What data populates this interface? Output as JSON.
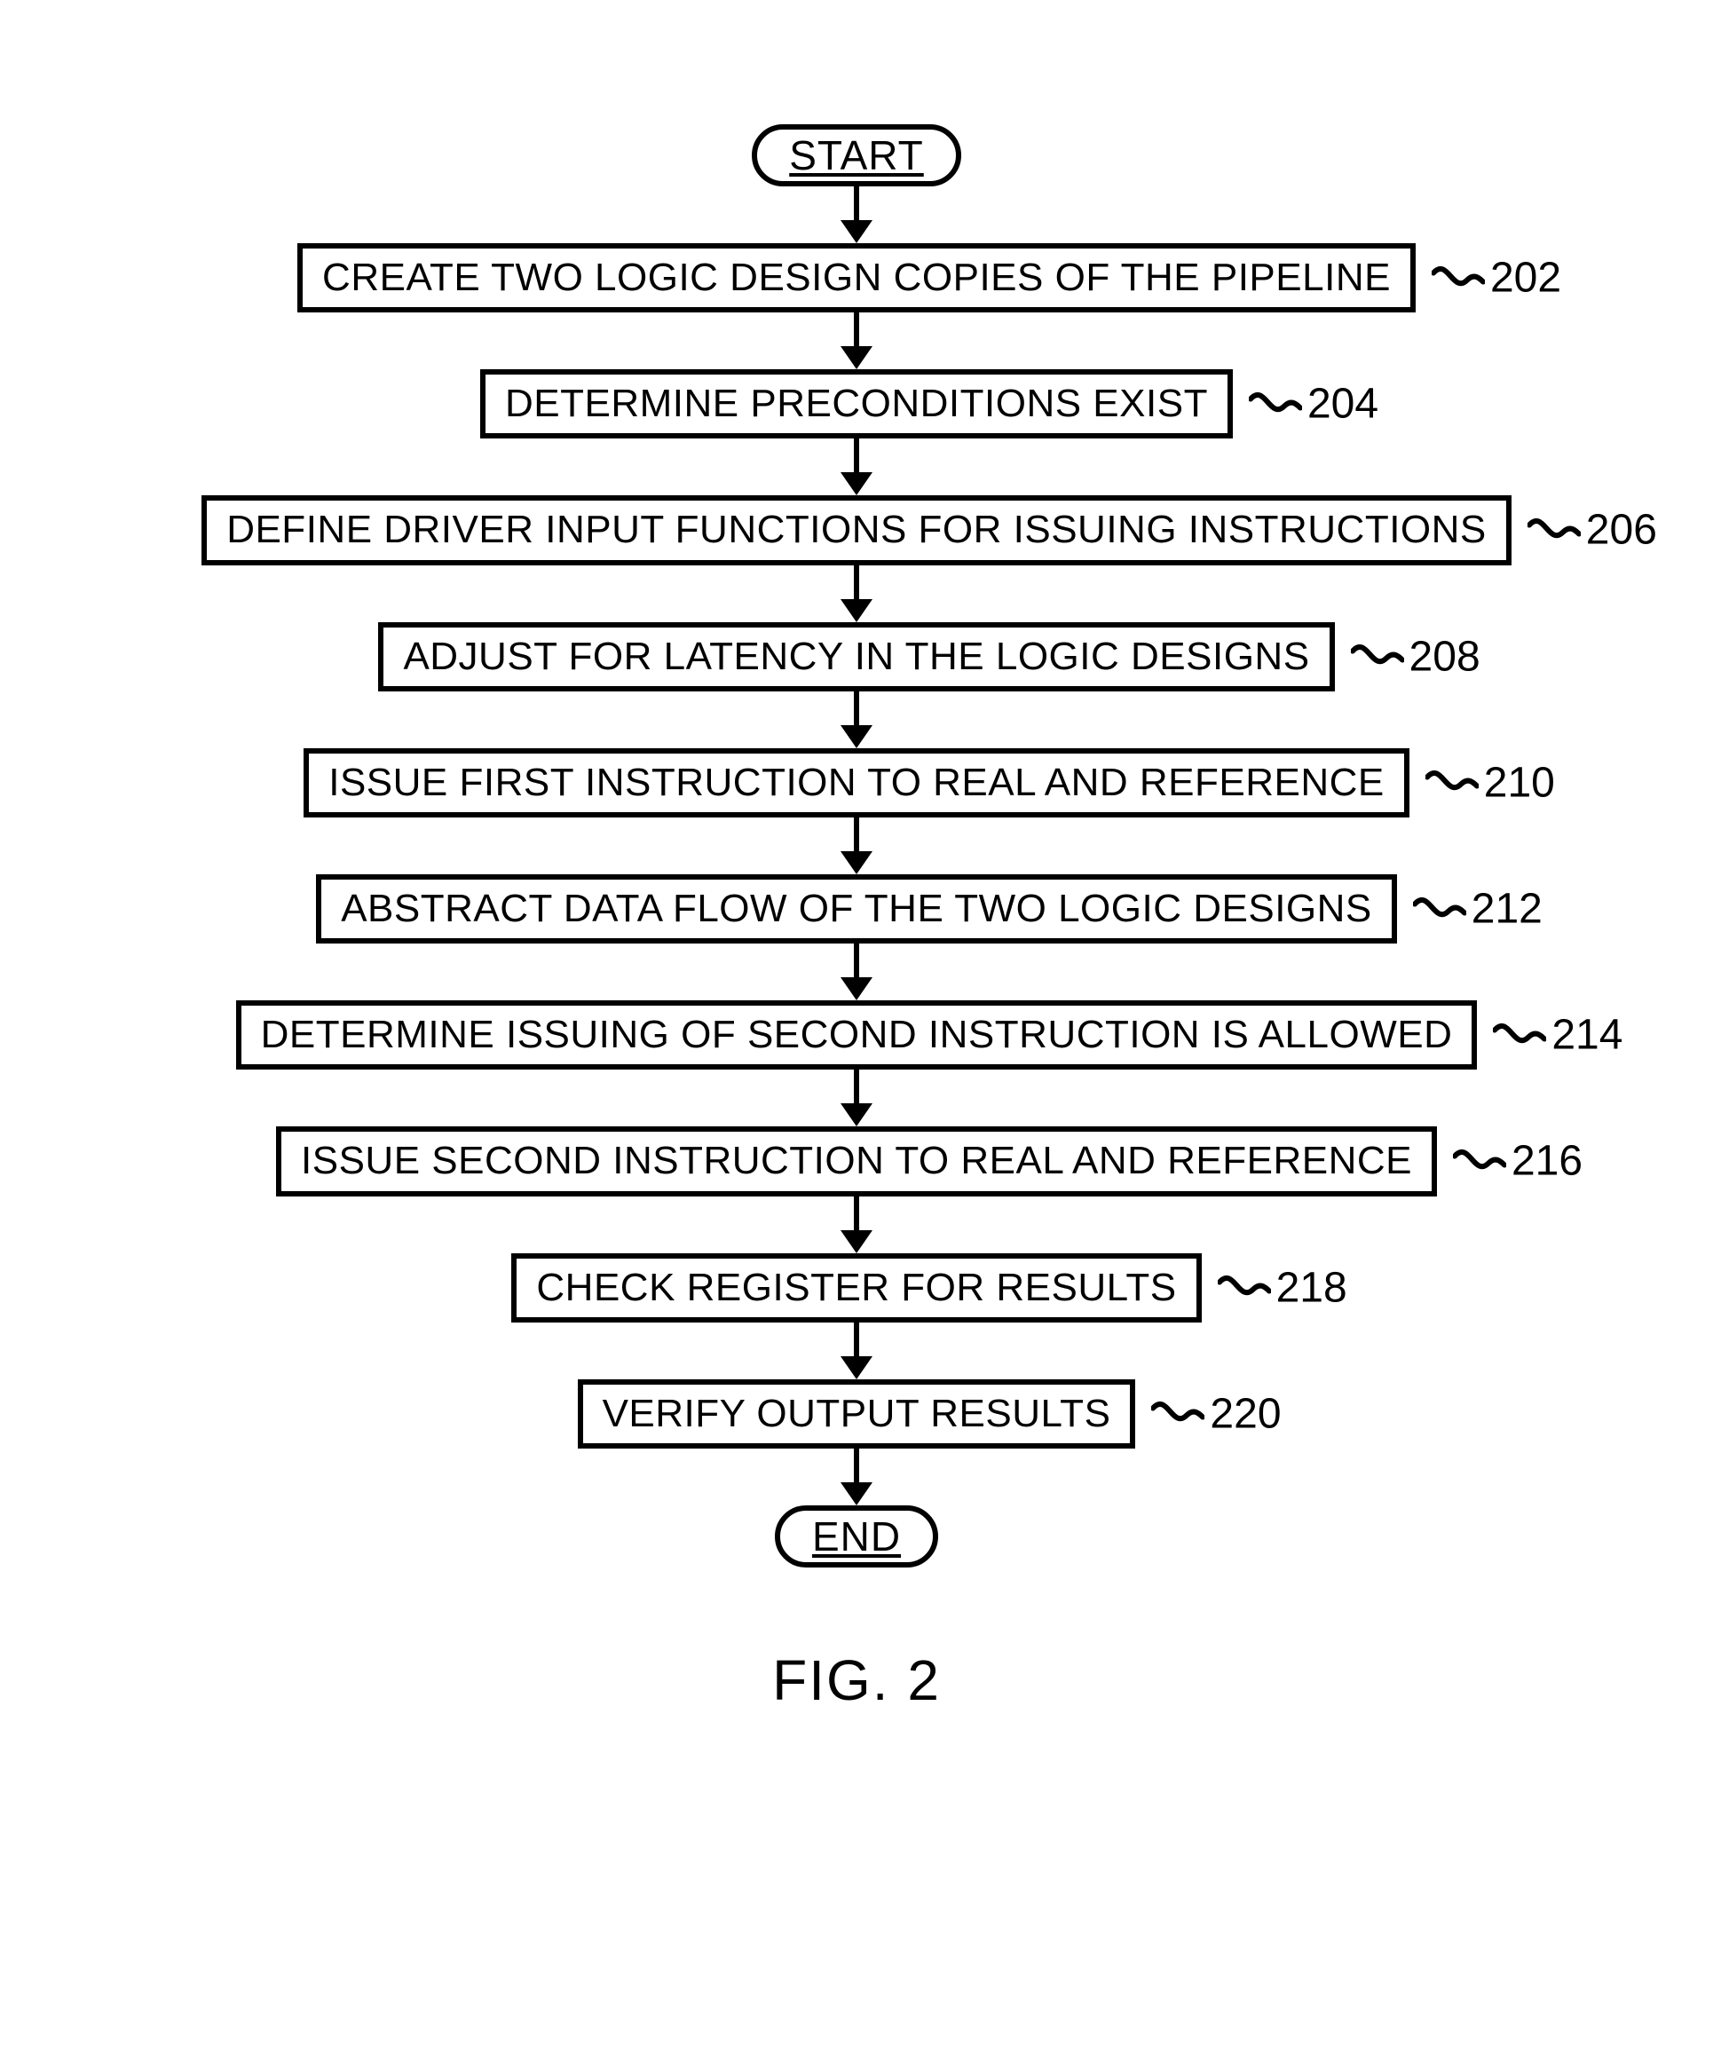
{
  "terminators": {
    "start": "START",
    "end": "END"
  },
  "steps": [
    {
      "text": "CREATE TWO LOGIC DESIGN COPIES OF THE PIPELINE",
      "ref": "202"
    },
    {
      "text": "DETERMINE PRECONDITIONS EXIST",
      "ref": "204"
    },
    {
      "text": "DEFINE DRIVER INPUT FUNCTIONS FOR ISSUING INSTRUCTIONS",
      "ref": "206"
    },
    {
      "text": "ADJUST FOR LATENCY IN THE LOGIC DESIGNS",
      "ref": "208"
    },
    {
      "text": "ISSUE FIRST INSTRUCTION TO REAL AND REFERENCE",
      "ref": "210"
    },
    {
      "text": "ABSTRACT DATA FLOW OF THE TWO LOGIC DESIGNS",
      "ref": "212"
    },
    {
      "text": "DETERMINE ISSUING OF SECOND INSTRUCTION IS ALLOWED",
      "ref": "214"
    },
    {
      "text": "ISSUE SECOND INSTRUCTION TO REAL AND REFERENCE",
      "ref": "216"
    },
    {
      "text": "CHECK REGISTER FOR RESULTS",
      "ref": "218"
    },
    {
      "text": "VERIFY OUTPUT RESULTS",
      "ref": "220"
    }
  ],
  "caption": "FIG. 2"
}
